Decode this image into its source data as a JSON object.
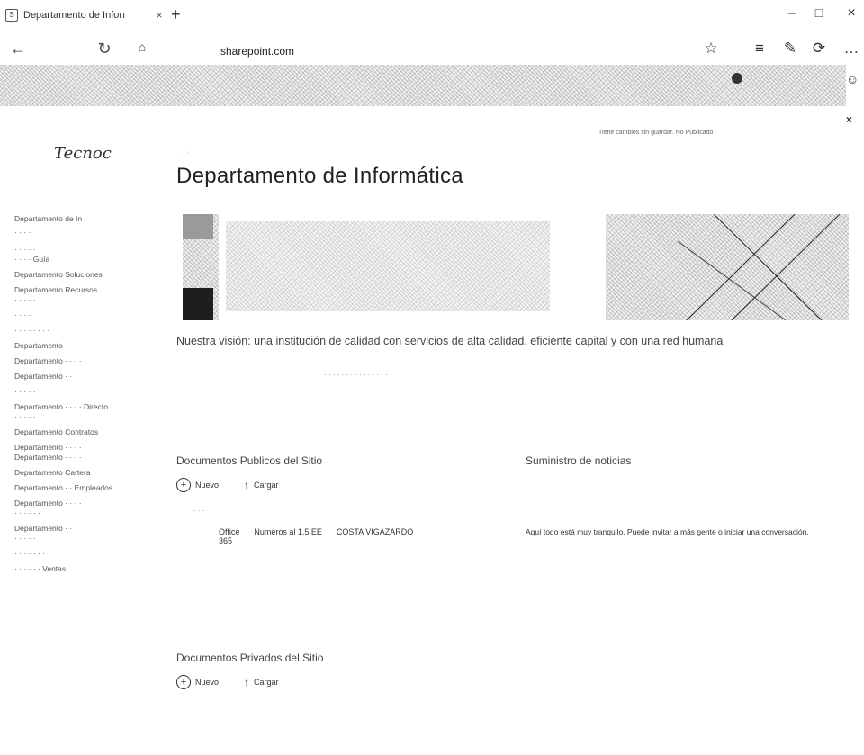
{
  "browser": {
    "tab_title": "Departamento de Inforı",
    "tab_close": "×",
    "new_tab": "+",
    "url": "sharepoint.com",
    "win_minimize": "–",
    "win_maximize": "□",
    "win_close": "×"
  },
  "promo": {
    "close": "×"
  },
  "site": {
    "logo": "Tecnoc",
    "tagline": "Tiene cambios sin guardar. No Publicado",
    "breadcrumb": "· ·",
    "title": "Departamento de Informática"
  },
  "sidebar": {
    "items": [
      "Departamento de In",
      "· · · ·",
      "· · · · ·",
      "· · · · Guía",
      "Departamento Soluciones",
      "Departamento Recursos",
      "· · · · ·",
      "· · · ·",
      "· · · · · · · ·",
      "Departamento · ·",
      "Departamento · · · · ·",
      "Departamento · ·",
      "· · · · ·",
      "Departamento · · · · Directo",
      "· · · · ·",
      "Departamento Contratos",
      "Departamento · · · · ·",
      "Departamento · · · · ·",
      "Departamento Cartera",
      "Departamento · · Empleados",
      "Departamento · · · · ·",
      "· · · · · ·",
      "Departamento · ·",
      "· · · · ·",
      "· · · · · · ·",
      "· · · · · · Ventas"
    ]
  },
  "mission": "Nuestra visión: una institución de calidad con servicios de alta calidad, eficiente capital y con una red humana",
  "public_docs": {
    "title": "Documentos Publicos del Sitio",
    "new_label": "Nuevo",
    "upload_label": "Cargar",
    "row": {
      "name": "Office",
      "version": "365",
      "detail": "Numeros al 1.5.EE",
      "author": "COSTA VIGAZARDO"
    }
  },
  "news": {
    "title": "Suministro de noticias",
    "empty_text": "Aquí todo está muy tranquilo. Puede invitar a más gente o iniciar una conversación."
  },
  "private_docs": {
    "title": "Documentos Privados del Sitio",
    "new_label": "Nuevo",
    "upload_label": "Cargar"
  }
}
